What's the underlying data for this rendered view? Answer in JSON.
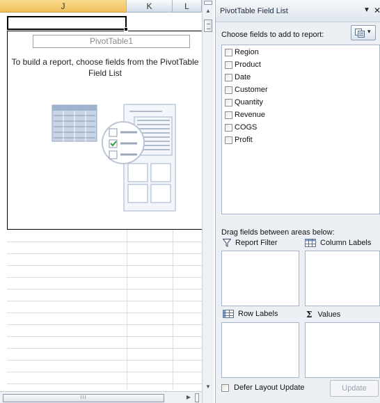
{
  "sheet": {
    "columns": [
      "J",
      "K",
      "L"
    ],
    "pivot_table_name": "PivotTable1",
    "instruction_line1": "To build a report, choose fields from the PivotTable",
    "instruction_line2": "Field List",
    "hscroll_grip": "III"
  },
  "panel": {
    "title": "PivotTable Field List",
    "dropdown_glyph": "▼",
    "close_glyph": "✕",
    "choose_label": "Choose fields to add to report:",
    "layout_button_caret": "▾",
    "fields": [
      "Region",
      "Product",
      "Date",
      "Customer",
      "Quantity",
      "Revenue",
      "COGS",
      "Profit"
    ],
    "drag_label": "Drag fields between areas below:",
    "areas": {
      "report_filter": "Report Filter",
      "column_labels": "Column Labels",
      "row_labels": "Row Labels",
      "values": "Values"
    },
    "defer_label": "Defer Layout Update",
    "update_button": "Update"
  },
  "icons": {
    "report_filter": "filter-icon",
    "column_labels": "column-grid-icon",
    "row_labels": "row-grid-icon",
    "values": "sigma-icon",
    "layout": "layout-icon"
  },
  "colors": {
    "selected_column_header": "#f1c15f",
    "panel_background": "#ecf0f5",
    "accent_blue": "#3b6ea5"
  }
}
